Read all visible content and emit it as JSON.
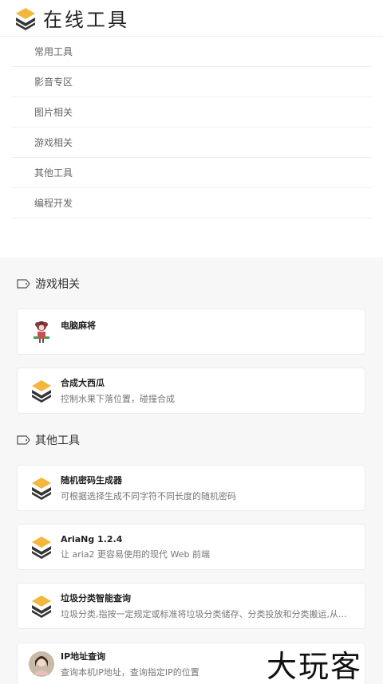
{
  "header": {
    "title": "在线工具",
    "logo_icon": "layers-logo-icon"
  },
  "nav": {
    "items": [
      {
        "label": "常用工具"
      },
      {
        "label": "影音专区"
      },
      {
        "label": "图片相关"
      },
      {
        "label": "游戏相关"
      },
      {
        "label": "其他工具"
      },
      {
        "label": "编程开发"
      }
    ]
  },
  "sections": [
    {
      "title": "游戏相关",
      "cards": [
        {
          "title": "电脑麻将",
          "desc": "",
          "icon": "mahjong-avatar-icon"
        },
        {
          "title": "合成大西瓜",
          "desc": "控制水果下落位置，碰撞合成",
          "icon": "layers-icon"
        }
      ]
    },
    {
      "title": "其他工具",
      "cards": [
        {
          "title": "随机密码生成器",
          "desc": "可根据选择生成不同字符不同长度的随机密码",
          "icon": "layers-icon"
        },
        {
          "title": "AriaNg 1.2.4",
          "desc": "让 aria2 更容易使用的现代 Web 前端",
          "icon": "layers-icon"
        },
        {
          "title": "垃圾分类智能查询",
          "desc": "垃圾分类,指按一定规定或标准将垃圾分类储存、分类投放和分类搬运,从...",
          "icon": "layers-icon"
        },
        {
          "title": "IP地址查询",
          "desc": "查询本机IP地址，查询指定IP的位置",
          "icon": "user-avatar-icon"
        }
      ]
    }
  ],
  "watermark": "大玩客",
  "colors": {
    "accent": "#f4b63d",
    "dark": "#3a3a3a",
    "background": "#f7f7f7"
  }
}
